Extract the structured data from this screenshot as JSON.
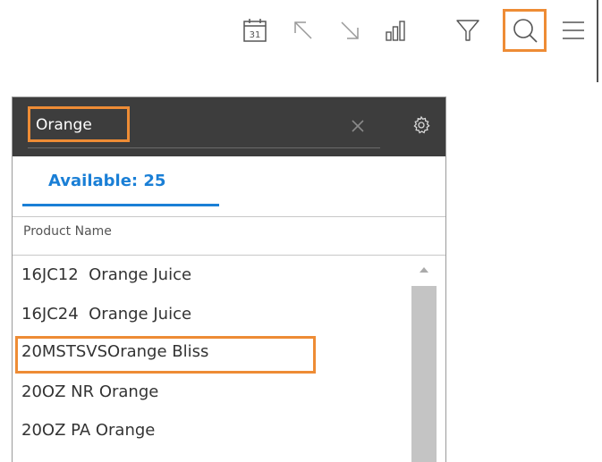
{
  "toolbar": {
    "calendar_day": "31",
    "icons": [
      "calendar-icon",
      "arrow-up-left-icon",
      "arrow-down-right-icon",
      "bar-chart-icon",
      "filter-icon",
      "search-icon",
      "menu-icon"
    ]
  },
  "search_panel": {
    "query": "Orange",
    "tab_available": "Available: 25",
    "column_header": "Product Name",
    "items": [
      "16JC12  Orange Juice",
      "16JC24  Orange Juice",
      "20MSTSVSOrange Bliss",
      "20OZ NR Orange",
      "20OZ PA Orange"
    ]
  },
  "colors": {
    "accent": "#1a7fd6",
    "highlight": "#ee8c35",
    "header_bg": "#3d3d3d"
  }
}
